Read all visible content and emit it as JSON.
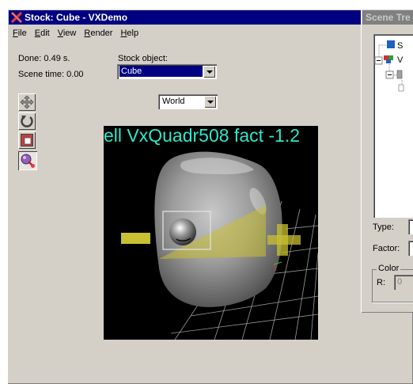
{
  "window": {
    "title": "Stock: Cube - VXDemo",
    "menu": [
      "File",
      "Edit",
      "View",
      "Render",
      "Help"
    ]
  },
  "stats": {
    "done": "Done: 0.49 s.",
    "scene_time": "Scene time: 0.00"
  },
  "stock": {
    "label": "Stock object:",
    "value": "Cube"
  },
  "coord_mode": {
    "value": "World"
  },
  "tools": [
    {
      "name": "move-icon"
    },
    {
      "name": "rotate-icon"
    },
    {
      "name": "scale-icon"
    },
    {
      "name": "deform-icon",
      "pressed": true
    }
  ],
  "viewport": {
    "overlay_text": "ell VxQuadr508  fact -1.2",
    "left_handle_label": "-",
    "right_handle_label": "+"
  },
  "scene_tree": {
    "title": "Scene Tre",
    "nodes": [
      "S",
      "V"
    ],
    "type_label": "Type:",
    "factor_label": "Factor:",
    "color_group_label": "Color",
    "r_label": "R:",
    "r_value": "0"
  },
  "colors": {
    "title_active": "#000080",
    "title_inactive": "#808080",
    "face": "#d4d0c8",
    "overlay_text": "#2ee8c8",
    "handle_yellow": "#c8c032"
  }
}
